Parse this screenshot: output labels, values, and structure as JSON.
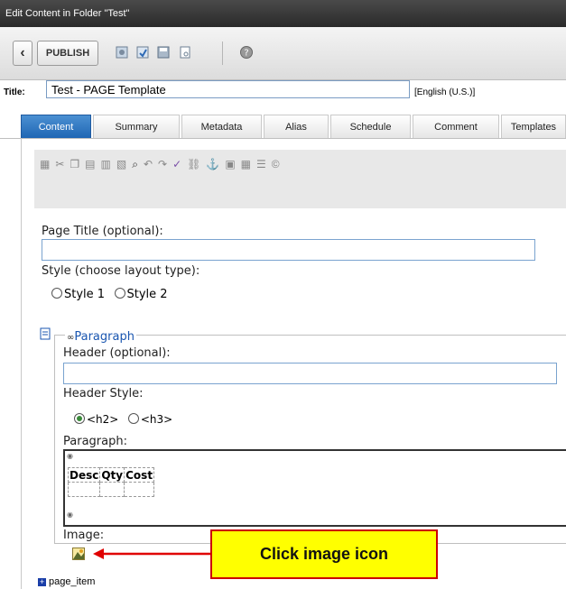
{
  "window": {
    "title": "Edit Content in Folder \"Test\""
  },
  "toolbar": {
    "publish_label": "PUBLISH"
  },
  "title_field": {
    "label": "Title:",
    "value": "Test - PAGE Template",
    "language": "[English (U.S.)]"
  },
  "tabs": [
    {
      "label": "Content"
    },
    {
      "label": "Summary"
    },
    {
      "label": "Metadata"
    },
    {
      "label": "Alias"
    },
    {
      "label": "Schedule"
    },
    {
      "label": "Comment"
    },
    {
      "label": "Templates"
    }
  ],
  "form": {
    "page_title_label": "Page Title (optional):",
    "style_label": "Style (choose layout type):",
    "style_options": [
      "Style 1",
      "Style 2"
    ],
    "paragraph_group": "Paragraph",
    "header_label": "Header (optional):",
    "header_style_label": "Header Style:",
    "header_style_options": [
      "<h2>",
      "<h3>"
    ],
    "paragraph_label": "Paragraph:",
    "table_headers": [
      "Desc",
      "Qty",
      "Cost"
    ],
    "image_label": "Image:",
    "page_item_label": "page_item"
  },
  "annotation": {
    "text": "Click image icon",
    "bg_color": "#ffff00",
    "border_color": "#cc0000"
  }
}
